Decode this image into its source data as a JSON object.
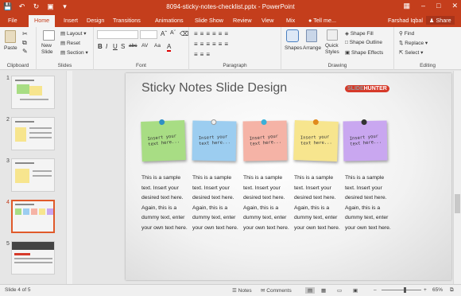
{
  "titlebar": {
    "title": "8094-sticky-notes-checklist.pptx - PowerPoint",
    "qat": [
      "save-icon",
      "undo-icon",
      "redo-icon",
      "present-icon",
      "customize-icon"
    ],
    "controls": [
      "ribbon-options-icon",
      "minimize-icon",
      "maximize-icon",
      "close-icon"
    ]
  },
  "tabs": [
    "File",
    "Home",
    "Insert",
    "Design",
    "Transitions",
    "Animations",
    "Slide Show",
    "Review",
    "View",
    "Mix"
  ],
  "active_tab": "Home",
  "tell_me": "Tell me...",
  "user": "Farshad Iqbal",
  "share": "Share",
  "ribbon": {
    "clipboard": {
      "paste": "Paste",
      "label": "Clipboard"
    },
    "slides": {
      "new_slide": "New\nSlide",
      "layout": "Layout",
      "reset": "Reset",
      "section": "Section",
      "label": "Slides"
    },
    "font": {
      "label": "Font",
      "bold": "B",
      "italic": "I",
      "underline": "U",
      "strike": "S",
      "abc": "abc",
      "spacing": "AV",
      "case": "Aa",
      "color": "A"
    },
    "paragraph": {
      "label": "Paragraph"
    },
    "drawing": {
      "shapes": "Shapes",
      "arrange": "Arrange",
      "quick_styles": "Quick\nStyles",
      "fill": "Shape Fill",
      "outline": "Shape Outline",
      "effects": "Shape Effects",
      "label": "Drawing"
    },
    "editing": {
      "find": "Find",
      "replace": "Replace",
      "select": "Select",
      "label": "Editing"
    }
  },
  "thumbnails": [
    "1",
    "2",
    "3",
    "4",
    "5"
  ],
  "selected_slide": "4",
  "slide": {
    "title": "Sticky Notes Slide Design",
    "logo_a": "SLIDE",
    "logo_b": "HUNTER",
    "notes": [
      {
        "text": "Insert your text here...",
        "color": "#a8dd84",
        "pin": "#2f8fc4"
      },
      {
        "text": "Insert your text here...",
        "color": "#9ccdf0",
        "pin": "#f0f0f0"
      },
      {
        "text": "Insert your text here...",
        "color": "#f5b3a6",
        "pin": "#3ab0d8"
      },
      {
        "text": "Insert your text here...",
        "color": "#f7e58e",
        "pin": "#e08a1c"
      },
      {
        "text": "Insert your text here...",
        "color": "#c9a7f0",
        "pin": "#333333"
      }
    ],
    "descriptions": [
      "This is a sample text. Insert your desired text here. Again, this is a dummy text, enter your own text here.",
      "This is a sample text. Insert your desired text here. Again, this is a dummy text, enter your own text here.",
      "This is a sample text. Insert your desired text here. Again, this is a dummy text, enter your own text here.",
      "This is a sample text. Insert your desired text here. Again, this is a dummy text, enter your own text here.",
      "This is a sample text. Insert your desired text here. Again, this is a dummy text, enter your own text here."
    ]
  },
  "status": {
    "slide_info": "Slide 4 of 5",
    "notes": "Notes",
    "comments": "Comments",
    "zoom": "65%"
  },
  "accent": "#c43e1c"
}
